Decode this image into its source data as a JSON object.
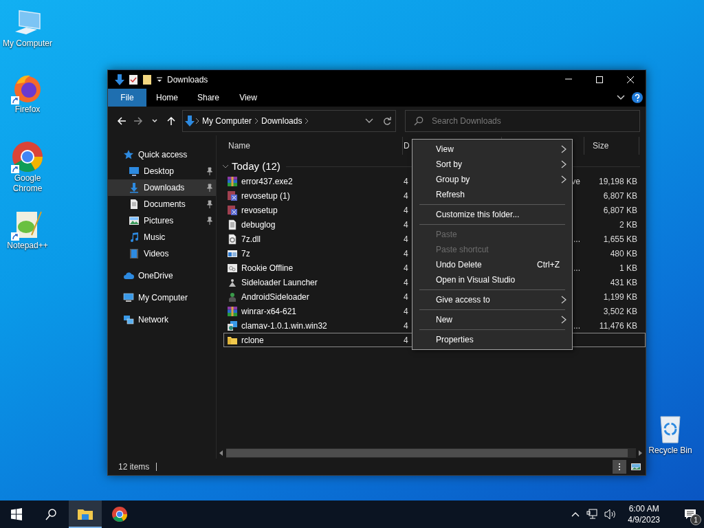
{
  "desktop_icons": [
    {
      "label": "My Computer",
      "kind": "computer",
      "shortcut": false
    },
    {
      "label": "Firefox",
      "kind": "fox",
      "shortcut": true
    },
    {
      "label": "Google Chrome",
      "kind": "ring",
      "shortcut": true
    },
    {
      "label": "Notepad++",
      "kind": "notepad",
      "shortcut": true
    },
    {
      "label": "Recycle Bin",
      "kind": "bin",
      "shortcut": false
    }
  ],
  "window": {
    "title": "Downloads",
    "ribbon_tabs": [
      {
        "label": "File",
        "kind": "file"
      },
      {
        "label": "Home",
        "kind": "tab"
      },
      {
        "label": "Share",
        "kind": "tab"
      },
      {
        "label": "View",
        "kind": "tab"
      }
    ],
    "address": {
      "segments": [
        "My Computer",
        "Downloads"
      ]
    },
    "search": {
      "placeholder": "Search Downloads"
    },
    "nav": [
      {
        "label": "Quick access",
        "kind": "star",
        "selected": false,
        "pinned": false,
        "children": [
          {
            "label": "Desktop",
            "kind": "desktop",
            "selected": false,
            "pinned": true
          },
          {
            "label": "Downloads",
            "kind": "download",
            "selected": true,
            "pinned": true
          },
          {
            "label": "Documents",
            "kind": "documents",
            "selected": false,
            "pinned": true
          },
          {
            "label": "Pictures",
            "kind": "pictures",
            "selected": false,
            "pinned": true
          },
          {
            "label": "Music",
            "kind": "music",
            "selected": false,
            "pinned": false
          },
          {
            "label": "Videos",
            "kind": "videos",
            "selected": false,
            "pinned": false
          }
        ]
      },
      {
        "label": "OneDrive",
        "kind": "cloud",
        "selected": false,
        "pinned": false
      },
      {
        "label": "My Computer",
        "kind": "computer",
        "selected": false,
        "pinned": false
      },
      {
        "label": "Network",
        "kind": "network",
        "selected": false,
        "pinned": false
      }
    ],
    "columns": [
      "Name",
      "D",
      "Size"
    ],
    "group": {
      "label": "Today (12)",
      "expanded": true
    },
    "files": [
      {
        "name": "error437.exe2",
        "kind": "archive",
        "date": "4",
        "type": "ve",
        "size": "19,198 KB",
        "focused": false
      },
      {
        "name": "revosetup (1)",
        "kind": "setup",
        "date": "4",
        "size": "6,807 KB",
        "focused": false
      },
      {
        "name": "revosetup",
        "kind": "setup",
        "date": "4",
        "size": "6,807 KB",
        "focused": false
      },
      {
        "name": "debuglog",
        "kind": "text",
        "date": "4",
        "size": "2 KB",
        "focused": false
      },
      {
        "name": "7z.dll",
        "kind": "dll",
        "date": "4",
        "type": "...",
        "size": "1,655 KB",
        "focused": false
      },
      {
        "name": "7z",
        "kind": "app",
        "date": "4",
        "size": "480 KB",
        "focused": false
      },
      {
        "name": "Rookie Offline",
        "kind": "config",
        "date": "4",
        "type": "...",
        "size": "1 KB",
        "focused": false
      },
      {
        "name": "Sideloader Launcher",
        "kind": "launcher",
        "date": "4",
        "size": "431 KB",
        "focused": false
      },
      {
        "name": "AndroidSideloader",
        "kind": "android",
        "date": "4",
        "size": "1,199 KB",
        "focused": false
      },
      {
        "name": "winrar-x64-621",
        "kind": "archive",
        "date": "4",
        "size": "3,502 KB",
        "focused": false
      },
      {
        "name": "clamav-1.0.1.win.win32",
        "kind": "installer",
        "date": "4",
        "type": "...",
        "size": "11,476 KB",
        "focused": false
      },
      {
        "name": "rclone",
        "kind": "folder",
        "date": "4",
        "focused": true
      }
    ],
    "status": {
      "count": "12 items"
    },
    "view_buttons": [
      {
        "kind": "details",
        "selected": true
      },
      {
        "kind": "large",
        "selected": false
      }
    ]
  },
  "context_menu": [
    {
      "kind": "item",
      "label": "View",
      "submenu": true,
      "disabled": false
    },
    {
      "kind": "item",
      "label": "Sort by",
      "submenu": true,
      "disabled": false
    },
    {
      "kind": "item",
      "label": "Group by",
      "submenu": true,
      "disabled": false
    },
    {
      "kind": "item",
      "label": "Refresh",
      "submenu": false,
      "disabled": false
    },
    {
      "kind": "separator"
    },
    {
      "kind": "item",
      "label": "Customize this folder...",
      "submenu": false,
      "disabled": false
    },
    {
      "kind": "separator"
    },
    {
      "kind": "item",
      "label": "Paste",
      "submenu": false,
      "disabled": true
    },
    {
      "kind": "item",
      "label": "Paste shortcut",
      "submenu": false,
      "disabled": true
    },
    {
      "kind": "item",
      "label": "Undo Delete",
      "shortcut": "Ctrl+Z",
      "submenu": false,
      "disabled": false
    },
    {
      "kind": "item",
      "label": "Open in Visual Studio",
      "submenu": false,
      "disabled": false
    },
    {
      "kind": "separator"
    },
    {
      "kind": "item",
      "label": "Give access to",
      "submenu": true,
      "disabled": false
    },
    {
      "kind": "separator"
    },
    {
      "kind": "item",
      "label": "New",
      "submenu": true,
      "disabled": false
    },
    {
      "kind": "separator"
    },
    {
      "kind": "item",
      "label": "Properties",
      "submenu": false,
      "disabled": false
    }
  ],
  "taskbar": {
    "apps": [
      {
        "kind": "start",
        "active": false
      },
      {
        "kind": "search",
        "active": false
      },
      {
        "kind": "explorer",
        "active": true
      },
      {
        "kind": "chrome",
        "active": false
      }
    ],
    "time": "6:00 AM",
    "date": "4/9/2023",
    "notifications": "1"
  }
}
